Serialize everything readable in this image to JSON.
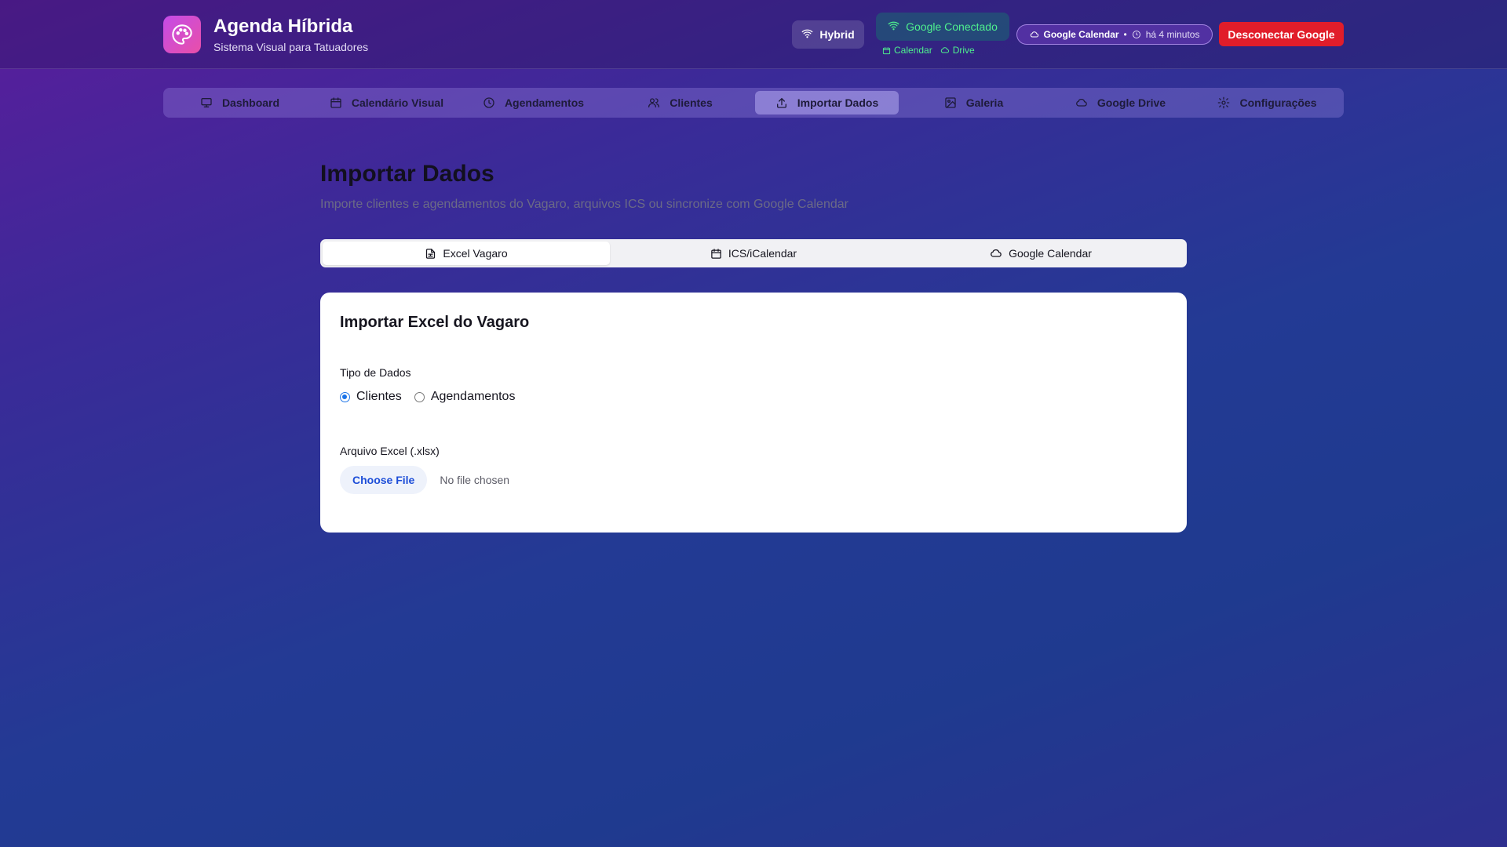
{
  "header": {
    "brand_title": "Agenda Híbrida",
    "brand_subtitle": "Sistema Visual para Tatuadores",
    "hybrid_label": "Hybrid",
    "google_status": "Google Conectado",
    "sub_links": {
      "calendar": "Calendar",
      "drive": "Drive"
    },
    "gcal_pill": {
      "service": "Google Calendar",
      "separator": "•",
      "time_ago": "há 4 minutos"
    },
    "disconnect_label": "Desconectar Google"
  },
  "nav": {
    "items": [
      {
        "label": "Dashboard",
        "icon": "monitor-icon"
      },
      {
        "label": "Calendário Visual",
        "icon": "calendar-icon"
      },
      {
        "label": "Agendamentos",
        "icon": "clock-icon"
      },
      {
        "label": "Clientes",
        "icon": "users-icon"
      },
      {
        "label": "Importar Dados",
        "icon": "upload-icon",
        "active": true
      },
      {
        "label": "Galeria",
        "icon": "image-icon"
      },
      {
        "label": "Google Drive",
        "icon": "cloud-icon"
      },
      {
        "label": "Configurações",
        "icon": "gear-icon"
      }
    ]
  },
  "page": {
    "title": "Importar Dados",
    "subtitle": "Importe clientes e agendamentos do Vagaro, arquivos ICS ou sincronize com Google Calendar"
  },
  "tabs": {
    "items": [
      {
        "label": "Excel Vagaro",
        "icon": "file-spreadsheet-icon",
        "active": true
      },
      {
        "label": "ICS/iCalendar",
        "icon": "calendar-icon"
      },
      {
        "label": "Google Calendar",
        "icon": "cloud-icon"
      }
    ]
  },
  "card": {
    "title": "Importar Excel do Vagaro",
    "data_type_label": "Tipo de Dados",
    "options": [
      {
        "label": "Clientes",
        "checked": true
      },
      {
        "label": "Agendamentos",
        "checked": false
      }
    ],
    "file_label": "Arquivo Excel (.xlsx)",
    "choose_file": "Choose File",
    "no_file": "No file chosen"
  },
  "colors": {
    "accent_red": "#e11d2a",
    "google_green": "#4ef08e",
    "radio_blue": "#1a73e8",
    "file_button_text": "#1d4ed8"
  }
}
